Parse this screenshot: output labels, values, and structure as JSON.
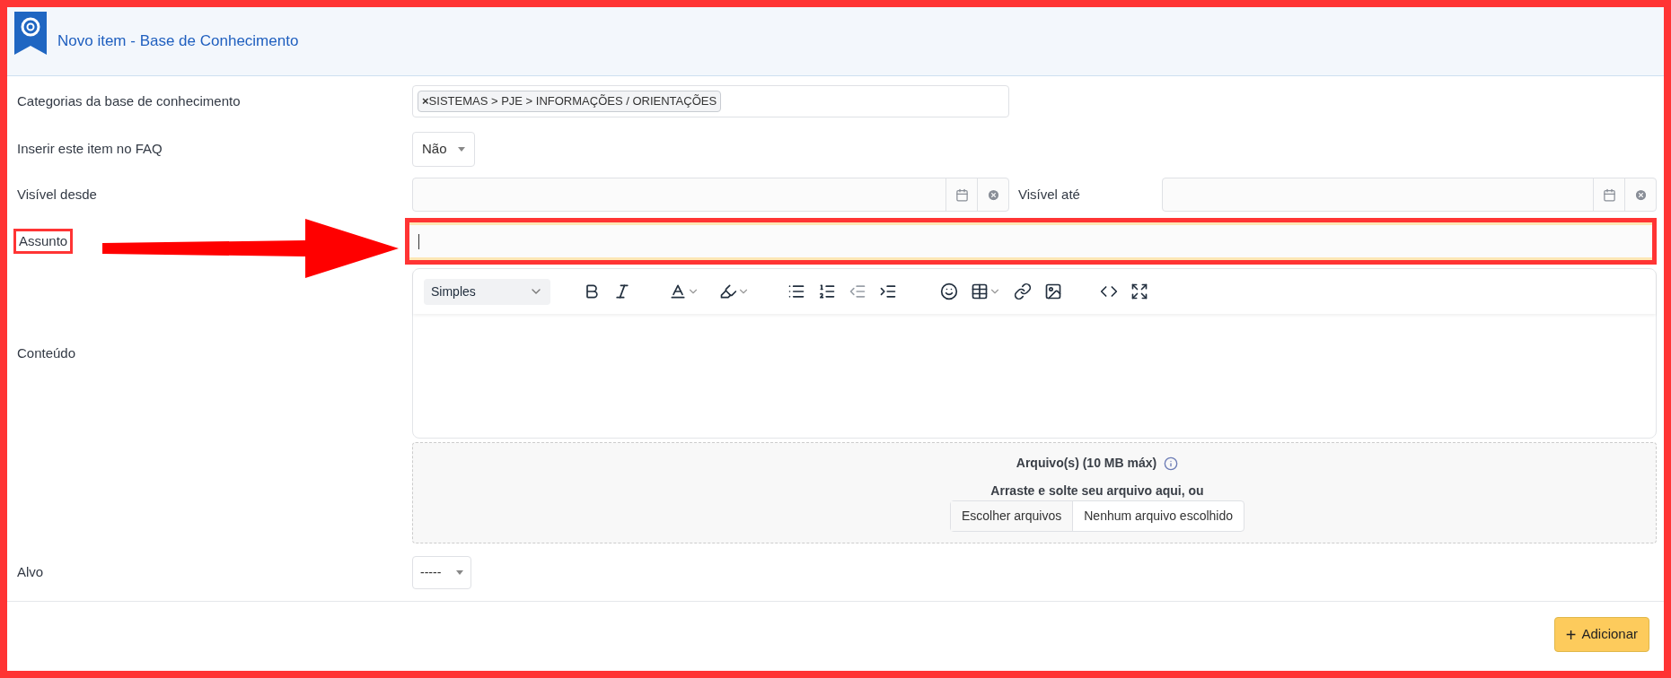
{
  "frame_annotated": true,
  "header": {
    "title": "Novo item - Base de Conhecimento"
  },
  "form": {
    "categories": {
      "label": "Categorias da base de conhecimento",
      "tags": [
        {
          "remove": "×",
          "text": "SISTEMAS > PJE > INFORMAÇÕES / ORIENTAÇÕES"
        }
      ]
    },
    "faq": {
      "label": "Inserir este item no FAQ",
      "value": "Não"
    },
    "visible_from": {
      "label": "Visível desde"
    },
    "visible_until": {
      "label": "Visível até"
    },
    "subject": {
      "label": "Assunto",
      "focused": true,
      "annotated": true
    },
    "content": {
      "label": "Conteúdo",
      "format": "Simples"
    },
    "attachments": {
      "title": "Arquivo(s) (10 MB máx)",
      "hint": "Arraste e solte seu arquivo aqui, ou",
      "choose": "Escolher arquivos",
      "status": "Nenhum arquivo escolhido"
    },
    "target": {
      "label": "Alvo",
      "value": "-----"
    }
  },
  "actions": [
    {
      "label": "Adicionar",
      "icon": "+"
    }
  ]
}
